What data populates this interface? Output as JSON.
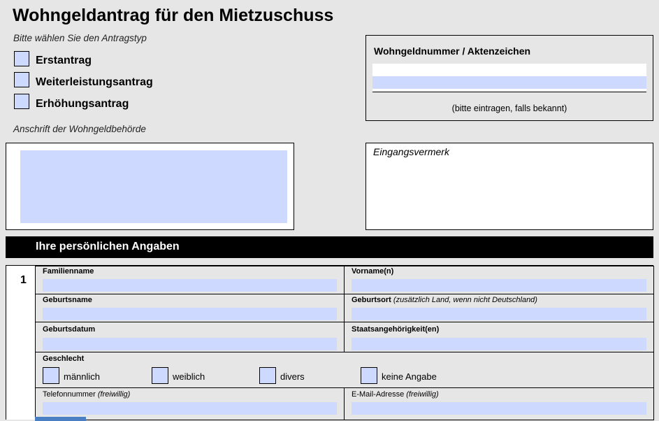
{
  "header": {
    "title": "Wohngeldantrag für den Mietzuschuss",
    "type_prompt": "Bitte wählen Sie den Antragstyp",
    "authority_prompt": "Anschrift der Wohngeldbehörde"
  },
  "application_types": [
    {
      "first": "E",
      "rest": "rstantrag"
    },
    {
      "first": "W",
      "rest": "eiterleistungsantrag"
    },
    {
      "first": "E",
      "rest": "rhöhungsantrag"
    }
  ],
  "reference_box": {
    "label": "Wohngeldnummer / Aktenzeichen",
    "hint": "(bitte eintragen, falls bekannt)"
  },
  "receipt_box": {
    "label": "Eingangsvermerk"
  },
  "section": {
    "title": "Ihre persönlichen Angaben",
    "number": "1"
  },
  "fields": {
    "familienname": "Familienname",
    "vorname": "Vorname(n)",
    "geburtsname": "Geburtsname",
    "geburtsort": "Geburtsort",
    "geburtsort_hint": "(zusätzlich Land, wenn nicht Deutschland)",
    "geburtsdatum": "Geburtsdatum",
    "staatsangehoerigkeit": "Staatsangehörigkeit(en)",
    "geschlecht": "Geschlecht",
    "telefon": "Telefonnummer",
    "telefon_hint": "(freiwillig)",
    "email": "E-Mail-Adresse",
    "email_hint": "(freiwillig)"
  },
  "gender_options": [
    "männlich",
    "weiblich",
    "divers",
    "keine Angabe"
  ]
}
